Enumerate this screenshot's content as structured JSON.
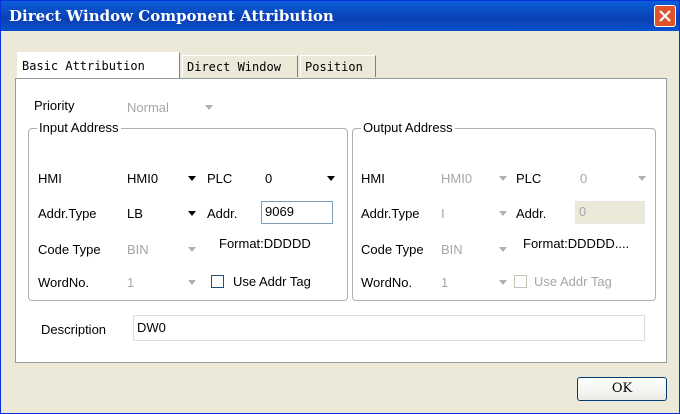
{
  "window": {
    "title": "Direct Window Component Attribution"
  },
  "tabs": [
    {
      "label": "Basic Attribution"
    },
    {
      "label": "Direct Window"
    },
    {
      "label": "Position"
    }
  ],
  "priority": {
    "label": "Priority",
    "value": "Normal"
  },
  "input_address": {
    "title": "Input Address",
    "hmi_label": "HMI",
    "hmi_value": "HMI0",
    "plc_label": "PLC",
    "plc_value": "0",
    "addr_type_label": "Addr.Type",
    "addr_type_value": "LB",
    "addr_label": "Addr.",
    "addr_value": "9069",
    "code_type_label": "Code Type",
    "code_type_value": "BIN",
    "format_text": "Format:DDDDD",
    "wordno_label": "WordNo.",
    "wordno_value": "1",
    "use_addr_tag_label": "Use Addr Tag"
  },
  "output_address": {
    "title": "Output Address",
    "hmi_label": "HMI",
    "hmi_value": "HMI0",
    "plc_label": "PLC",
    "plc_value": "0",
    "addr_type_label": "Addr.Type",
    "addr_type_value": "I",
    "addr_label": "Addr.",
    "addr_value": "0",
    "code_type_label": "Code Type",
    "code_type_value": "BIN",
    "format_text": "Format:DDDDD....",
    "wordno_label": "WordNo.",
    "wordno_value": "1",
    "use_addr_tag_label": "Use Addr Tag"
  },
  "description": {
    "label": "Description",
    "value": "DW0"
  },
  "ok_button": {
    "label": "OK"
  },
  "colors": {
    "titlebar": "#0a4fc8",
    "dialog_bg": "#ece9d8",
    "close": "#e0532a"
  }
}
